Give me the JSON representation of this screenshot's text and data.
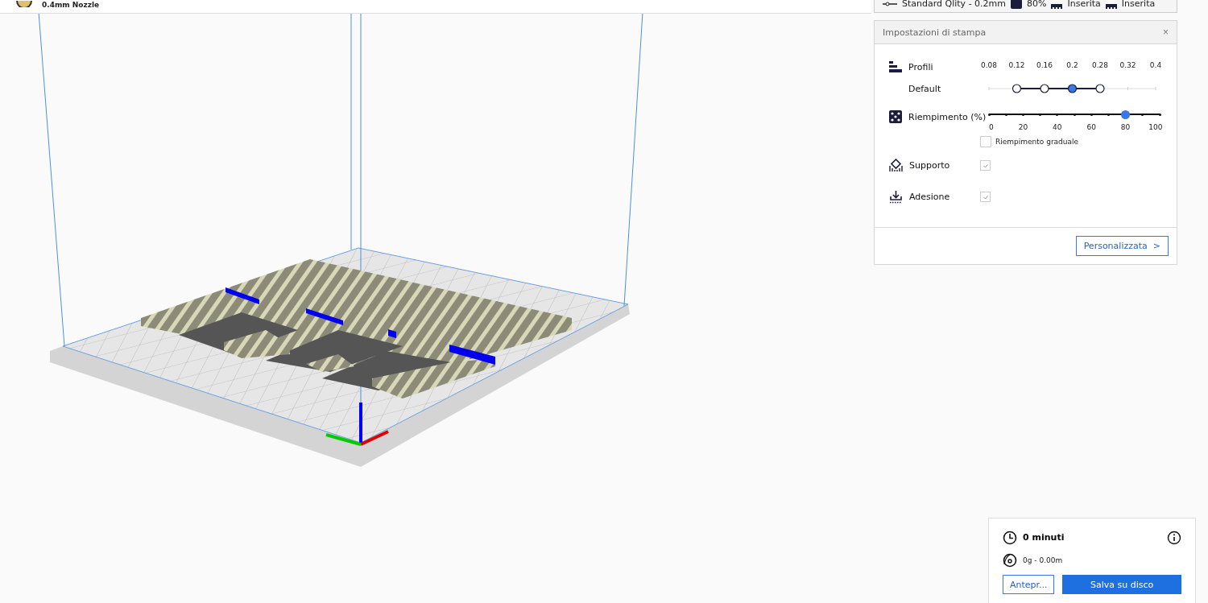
{
  "header": {
    "nozzle": "0.4mm Nozzle"
  },
  "summary_bar": {
    "profile": "Standard Qlity - 0.2mm",
    "infill": "80%",
    "support": "Inserita",
    "adhesion": "Inserita"
  },
  "print_settings": {
    "title": "Impostazioni di stampa",
    "close": "×",
    "profiles": {
      "label": "Profili",
      "current": "Default",
      "options": [
        {
          "label": "0.08",
          "available": false,
          "selected": false
        },
        {
          "label": "0.12",
          "available": true,
          "selected": false
        },
        {
          "label": "0.16",
          "available": true,
          "selected": false
        },
        {
          "label": "0.2",
          "available": true,
          "selected": true
        },
        {
          "label": "0.28",
          "available": true,
          "selected": false
        },
        {
          "label": "0.32",
          "available": false,
          "selected": false
        },
        {
          "label": "0.4",
          "available": false,
          "selected": false
        }
      ]
    },
    "infill": {
      "label": "Riempimento (%)",
      "level": 0.8,
      "ticks": [
        "0",
        "20",
        "40",
        "60",
        "80",
        "100"
      ],
      "gradual": {
        "label": "Riempimento graduale",
        "checked": false
      }
    },
    "support": {
      "label": "Supporto",
      "checked": true
    },
    "adhesion": {
      "label": "Adesione",
      "checked": true
    },
    "custom_button": "Personalizzata",
    "custom_chevron": ">"
  },
  "job": {
    "time": "0 minuti",
    "material": "0g - 0.00m",
    "preview_button": "Antepr...",
    "save_button": "Salva su disco"
  }
}
